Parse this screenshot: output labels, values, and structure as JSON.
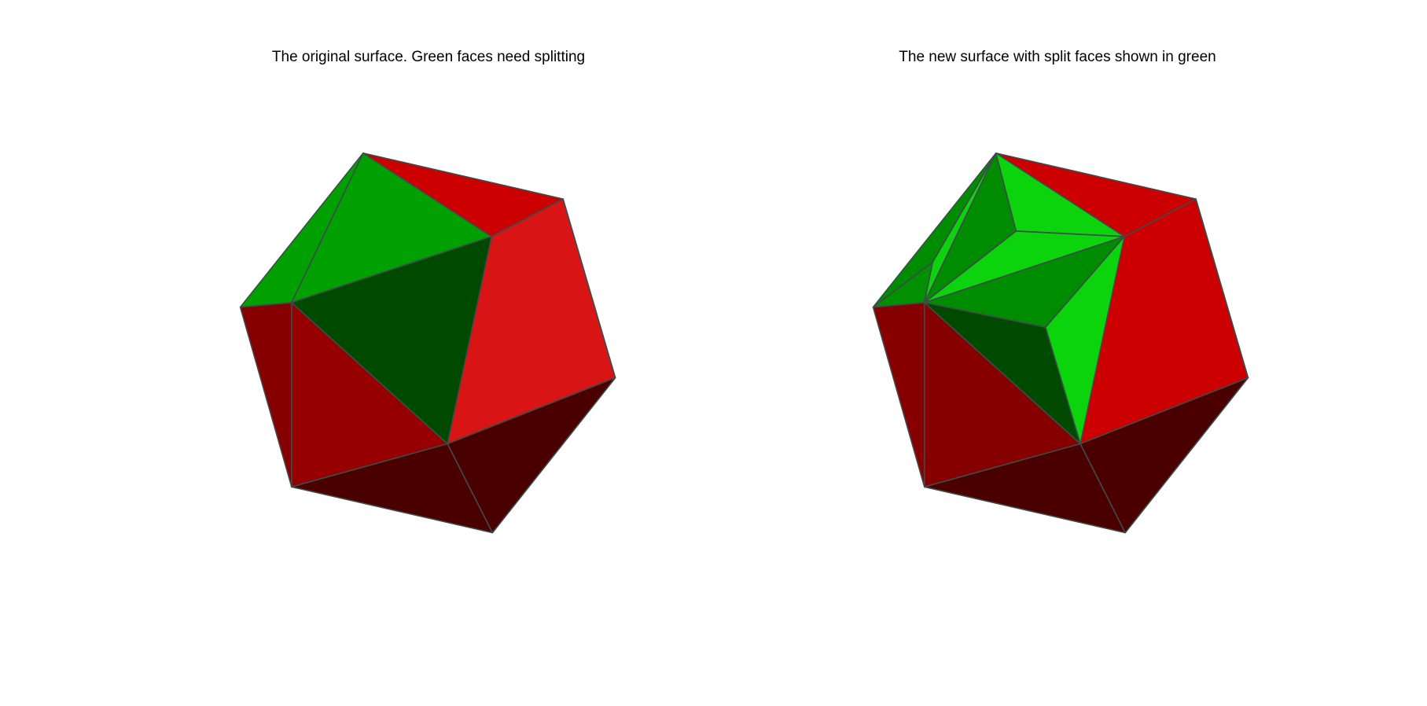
{
  "figure": {
    "left_panel": {
      "title": "The original surface. Green faces need splitting"
    },
    "right_panel": {
      "title": "The new surface with split faces shown in green"
    }
  },
  "colors": {
    "background": "#ffffff",
    "edge": "#3f4a4a",
    "red_top": "#cc0000",
    "red_right": "#d91414",
    "red_left_front": "#960000",
    "red_left": "#870000",
    "red_bottom": "#4b0000",
    "green_top": "#00a000",
    "green_left": "#009000",
    "green_dark": "#004a00",
    "green_bright": "#0cd40c",
    "green_mid": "#008c00"
  }
}
